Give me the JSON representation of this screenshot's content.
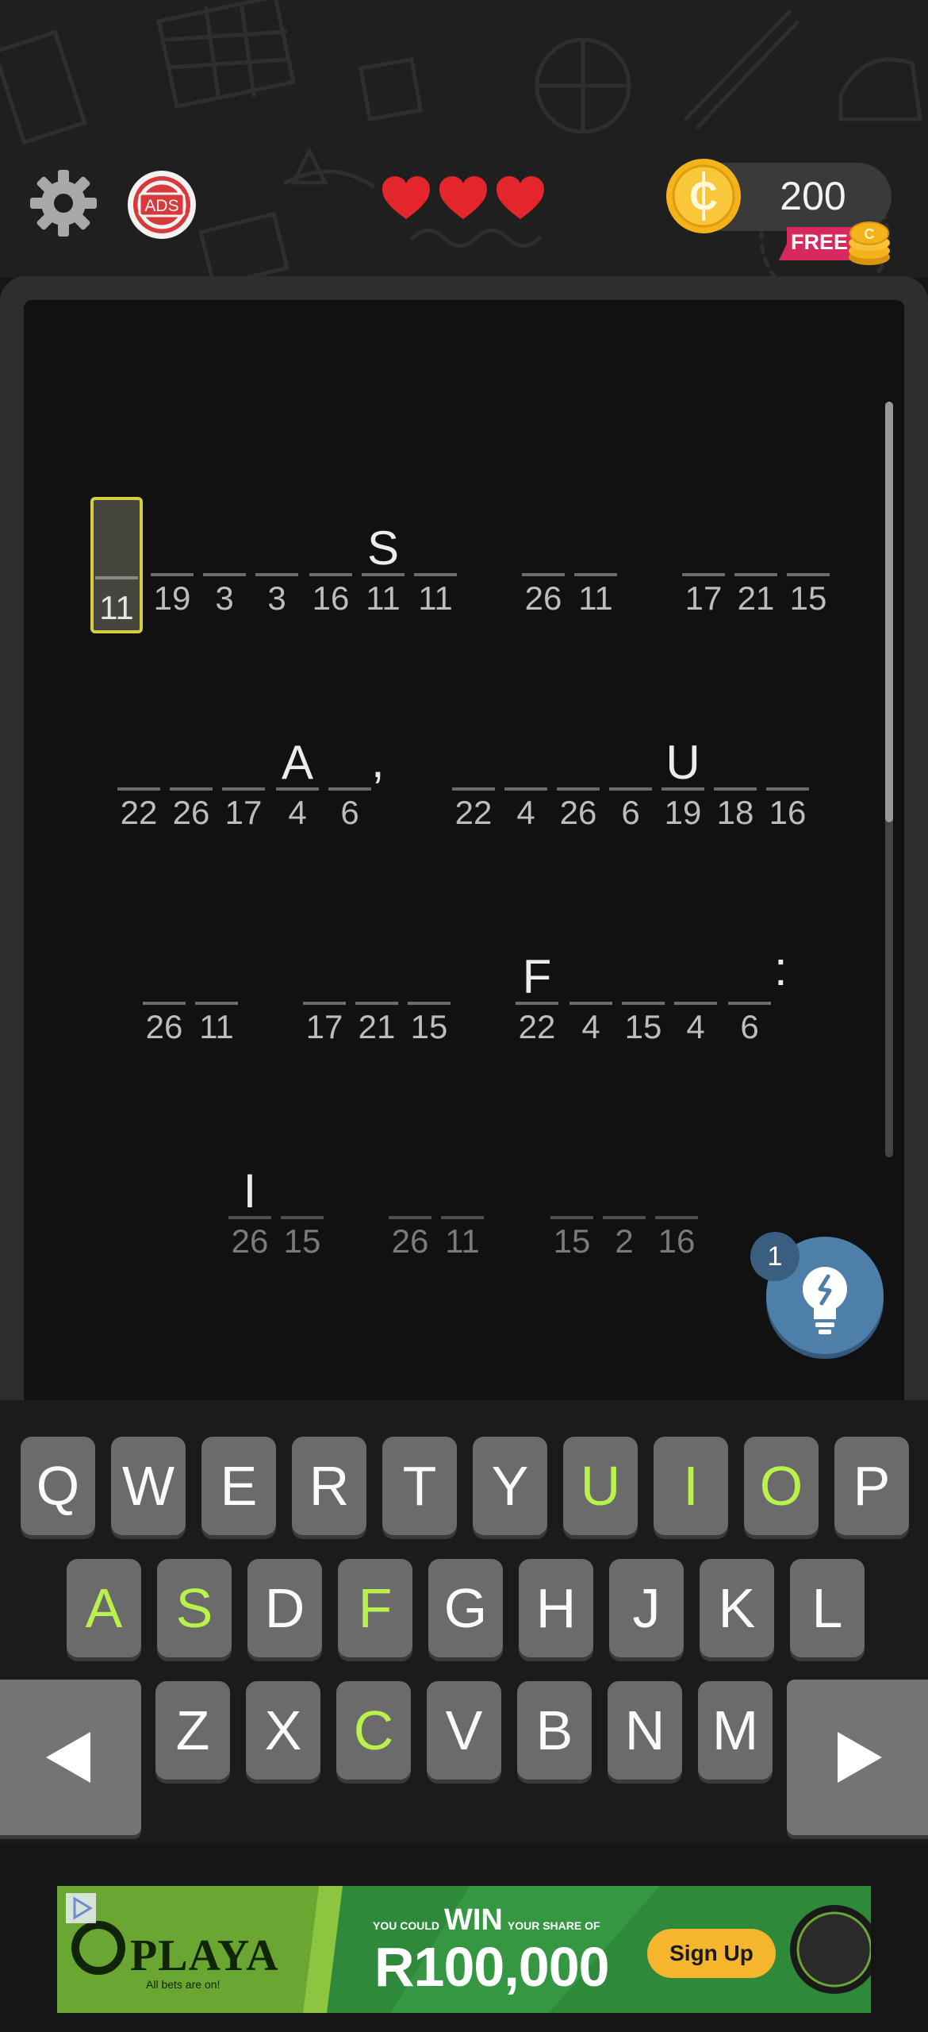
{
  "header": {
    "settings_icon": "gear-icon",
    "no_ads_label": "ADS",
    "lives": 3,
    "coins": "200",
    "free_label": "FREE"
  },
  "board": {
    "selected_cell": "11",
    "row1": [
      {
        "n": "11",
        "l": "",
        "sel": true
      },
      {
        "n": "19",
        "l": ""
      },
      {
        "n": "3",
        "l": ""
      },
      {
        "n": "3",
        "l": ""
      },
      {
        "n": "16",
        "l": ""
      },
      {
        "n": "11",
        "l": "S"
      },
      {
        "n": "11",
        "l": ""
      },
      {
        "n": "26",
        "l": ""
      },
      {
        "n": "11",
        "l": ""
      },
      {
        "n": "17",
        "l": ""
      },
      {
        "n": "21",
        "l": ""
      },
      {
        "n": "15",
        "l": ""
      }
    ],
    "row2": [
      {
        "n": "22",
        "l": ""
      },
      {
        "n": "26",
        "l": ""
      },
      {
        "n": "17",
        "l": ""
      },
      {
        "n": "4",
        "l": "A"
      },
      {
        "n": "6",
        "l": ""
      },
      {
        "n": "22",
        "l": ""
      },
      {
        "n": "4",
        "l": ""
      },
      {
        "n": "26",
        "l": ""
      },
      {
        "n": "6",
        "l": ""
      },
      {
        "n": "19",
        "l": "U"
      },
      {
        "n": "18",
        "l": ""
      },
      {
        "n": "16",
        "l": ""
      }
    ],
    "row2_punct": ",",
    "row3": [
      {
        "n": "26",
        "l": ""
      },
      {
        "n": "11",
        "l": ""
      },
      {
        "n": "17",
        "l": ""
      },
      {
        "n": "21",
        "l": ""
      },
      {
        "n": "15",
        "l": ""
      },
      {
        "n": "22",
        "l": "F"
      },
      {
        "n": "4",
        "l": ""
      },
      {
        "n": "15",
        "l": ""
      },
      {
        "n": "4",
        "l": ""
      },
      {
        "n": "6",
        "l": ""
      }
    ],
    "row3_punct": ":",
    "row4": [
      {
        "n": "26",
        "l": "I"
      },
      {
        "n": "15",
        "l": ""
      },
      {
        "n": "26",
        "l": ""
      },
      {
        "n": "11",
        "l": ""
      },
      {
        "n": "15",
        "l": ""
      },
      {
        "n": "2",
        "l": ""
      },
      {
        "n": "16",
        "l": ""
      }
    ],
    "hint_count": "1"
  },
  "keyboard": {
    "row1": [
      "Q",
      "W",
      "E",
      "R",
      "T",
      "Y",
      "U",
      "I",
      "O",
      "P"
    ],
    "row2": [
      "A",
      "S",
      "D",
      "F",
      "G",
      "H",
      "J",
      "K",
      "L"
    ],
    "row3": [
      "Z",
      "X",
      "C",
      "V",
      "B",
      "N",
      "M"
    ],
    "used_letters": [
      "U",
      "I",
      "O",
      "A",
      "S",
      "F",
      "C"
    ],
    "used_color": "#b8f24a"
  },
  "ad": {
    "brand": "PLAYA",
    "brand_sub": "All bets are on!",
    "line1": "WIN",
    "line1_pre": "YOU COULD",
    "line1_post": "YOUR SHARE OF",
    "amount": "R100,000",
    "button": "Sign Up"
  },
  "colors": {
    "background": "#161616",
    "board": "#111111",
    "frame": "#2e2e2e",
    "selected_outline": "#d7ce3f",
    "heart": "#e3262b",
    "coin": "#f4b21b",
    "hint_button": "#4d7fa8"
  }
}
